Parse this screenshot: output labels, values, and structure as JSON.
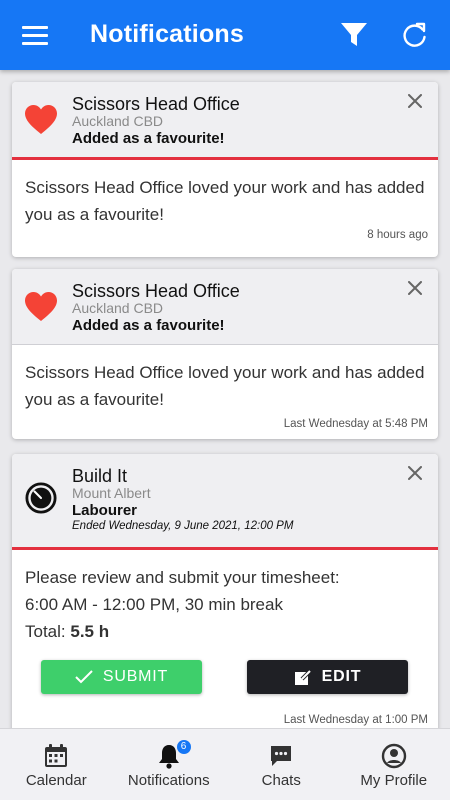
{
  "header": {
    "title": "Notifications"
  },
  "notifications": [
    {
      "company": "Scissors Head Office",
      "location": "Auckland CBD",
      "subject": "Added as a favourite!",
      "message": "Scissors Head Office loved your work and has added you as a favourite!",
      "time": "8 hours ago"
    },
    {
      "company": "Scissors Head Office",
      "location": "Auckland CBD",
      "subject": "Added as a favourite!",
      "message": "Scissors Head Office loved your work and has added you as a favourite!",
      "time": "Last Wednesday at 5:48 PM"
    },
    {
      "company": "Build It",
      "location": "Mount Albert",
      "subject": "Labourer",
      "ended": "Ended Wednesday, 9 June 2021, 12:00 PM",
      "line1": "Please review and submit your timesheet:",
      "line2": "6:00 AM - 12:00 PM, 30 min break",
      "total_label": "Total:",
      "total_value": "5.5 h",
      "submit_label": "SUBMIT",
      "edit_label": "EDIT",
      "time": "Last Wednesday at 1:00 PM"
    }
  ],
  "bottom_nav": {
    "items": [
      {
        "label": "Calendar",
        "icon": "calendar-icon"
      },
      {
        "label": "Notifications",
        "icon": "bell-icon",
        "badge": "6"
      },
      {
        "label": "Chats",
        "icon": "chat-bubble-icon"
      },
      {
        "label": "My Profile",
        "icon": "user-circle-icon"
      }
    ]
  },
  "colors": {
    "primary": "#1677f5",
    "heart": "#f44336",
    "divider": "#e3303f",
    "submit": "#3ecf6b",
    "edit": "#1f2025"
  }
}
